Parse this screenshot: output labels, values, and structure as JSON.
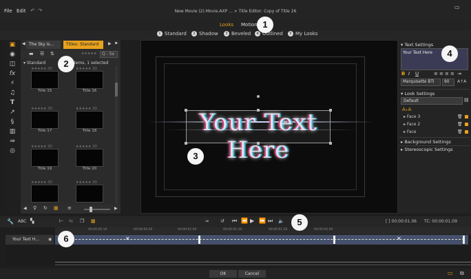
{
  "menu": {
    "file": "File",
    "edit": "Edit"
  },
  "document_title": "New Movie (2).Movie.AXP ... > Title Editor: Copy of Title 26",
  "tabs": [
    {
      "label": "Looks",
      "active": true
    },
    {
      "label": "Motions",
      "active": false
    }
  ],
  "style_filters": [
    {
      "num": "1",
      "label": "Standard"
    },
    {
      "num": "2",
      "label": "Shadow"
    },
    {
      "num": "3",
      "label": "Beveled"
    },
    {
      "num": "4",
      "label": "Outlined"
    },
    {
      "num": "5",
      "label": "My Looks"
    }
  ],
  "callouts": [
    "1",
    "2",
    "3",
    "4",
    "5",
    "6"
  ],
  "library": {
    "tab1": "The Sky is...",
    "tab2": "Titles: Standard",
    "search_placeholder": "Q - Se",
    "breadcrumb": "Standard",
    "count": "7 items, 1 selected",
    "rating": "3D",
    "items": [
      {
        "label": "Title 15"
      },
      {
        "label": "Title 16"
      },
      {
        "label": "Title 17"
      },
      {
        "label": "Title 18"
      },
      {
        "label": "Title 19"
      },
      {
        "label": "Title 20"
      },
      {
        "label": ""
      },
      {
        "label": ""
      }
    ]
  },
  "preview": {
    "title_text": "Your Text Here"
  },
  "right_panel": {
    "text_settings": "Text Settings",
    "text_value": "Your Text Here",
    "bold": "B",
    "italic": "I",
    "underline": "U",
    "font": "Marquisette BTI",
    "size": "90",
    "look_settings": "Look Settings",
    "preset": "Default",
    "faces": [
      {
        "label": "Face 3",
        "color": "#e8a21e"
      },
      {
        "label": "Face 2",
        "color": "#e8a21e"
      },
      {
        "label": "Face",
        "color": "#e8a21e"
      }
    ],
    "background_settings": "Background Settings",
    "stereoscopic_settings": "Stereoscopic Settings"
  },
  "timeline": {
    "timecode_left": "[ ] 00:00:01.06",
    "timecode_right": "TC: 00:00:01.09",
    "ruler_marks": [
      "00:00:00.00",
      "00:00:00.10",
      "00:00:00.20",
      "00:00:01.00",
      "00:00:01.10",
      "00:00:01.20",
      "00:00:02.00"
    ],
    "track_name": "Your Text H..."
  },
  "buttons": {
    "ok": "OK",
    "cancel": "Cancel"
  },
  "accent_color": "#e8a21e"
}
